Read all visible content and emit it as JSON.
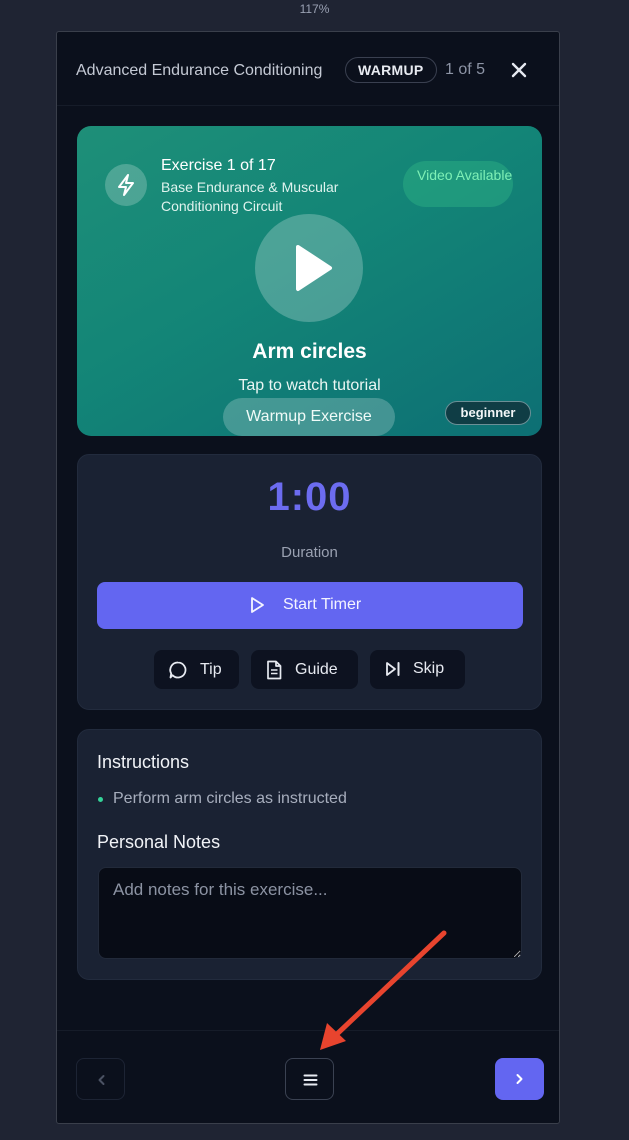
{
  "browser": {
    "zoom_level": "117%"
  },
  "header": {
    "title": "Advanced Endurance Conditioning",
    "phase_badge": "WARMUP",
    "progress": "1 of 5",
    "close_icon": "x-close-icon"
  },
  "hero": {
    "exercise_count": "Exercise 1 of 17",
    "circuit_name": "Base Endurance & Muscular Conditioning Circuit",
    "video_badge": "Video Available",
    "exercise_name": "Arm circles",
    "tap_hint": "Tap to watch tutorial",
    "exercise_type": "Warmup Exercise",
    "level": "beginner",
    "bolt_icon": "lightning-bolt-icon",
    "play_icon": "play-icon"
  },
  "timer": {
    "value": "1:00",
    "label": "Duration",
    "start_label": "Start Timer",
    "tip_label": "Tip",
    "guide_label": "Guide",
    "skip_label": "Skip"
  },
  "instructions": {
    "title": "Instructions",
    "items": [
      "Perform arm circles as instructed"
    ]
  },
  "notes": {
    "title": "Personal Notes",
    "placeholder": "Add notes for this exercise...",
    "value": ""
  },
  "footer": {
    "prev_icon": "chevron-left-icon",
    "menu_icon": "menu-icon",
    "next_icon": "chevron-right-icon"
  },
  "colors": {
    "accent": "#6366f1",
    "timer": "#6c6cf0",
    "hero_start": "#1e8f78",
    "hero_end": "#0d6f74",
    "annotation_arrow": "#e8442e"
  }
}
